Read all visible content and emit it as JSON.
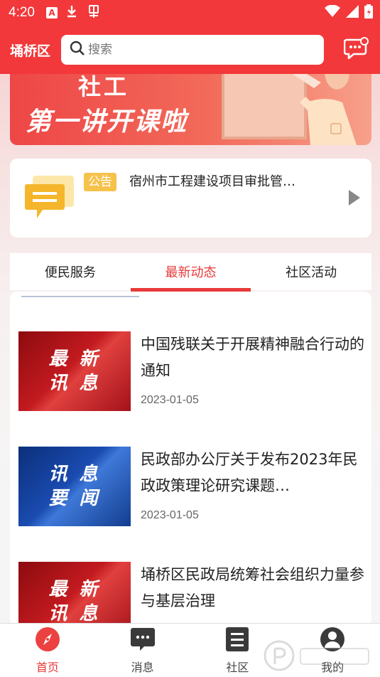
{
  "status_bar": {
    "time": "4:20",
    "icons": [
      "a-app-icon",
      "download-icon",
      "bug-icon"
    ],
    "right_icons": [
      "wifi-icon",
      "signal-icon",
      "battery-icon"
    ]
  },
  "header": {
    "district": "埇桥区",
    "search_placeholder": "搜索"
  },
  "banner": {
    "line1": "社工",
    "line2": "第一讲开课啦"
  },
  "notice": {
    "badge": "公告",
    "text": "宿州市工程建设项目审批管…"
  },
  "tabs": [
    {
      "label": "便民服务",
      "active": false
    },
    {
      "label": "最新动态",
      "active": true
    },
    {
      "label": "社区活动",
      "active": false
    }
  ],
  "news": [
    {
      "thumb_text_1": "最 新",
      "thumb_text_2": "讯 息",
      "title": "中国残联关于开展精神融合行动的通知",
      "date": "2023-01-05",
      "thumb_color": "red"
    },
    {
      "thumb_text_1": "讯 息",
      "thumb_text_2": "要 闻",
      "title": "民政部办公厅关于发布2023年民政政策理论研究课题…",
      "date": "2023-01-05",
      "thumb_color": "blue"
    },
    {
      "thumb_text_1": "最 新",
      "thumb_text_2": "讯 息",
      "title": "埇桥区民政局统筹社会组织力量参与基层治理",
      "date": "",
      "thumb_color": "red"
    }
  ],
  "bottom_nav": [
    {
      "label": "首页",
      "icon": "compass-icon",
      "active": true
    },
    {
      "label": "消息",
      "icon": "chat-icon",
      "active": false
    },
    {
      "label": "社区",
      "icon": "list-icon",
      "active": false
    },
    {
      "label": "我的",
      "icon": "user-icon",
      "active": false
    }
  ],
  "colors": {
    "primary": "#f2383a",
    "accent_red": "#e83a3a",
    "badge_yellow": "#f7c24a"
  }
}
